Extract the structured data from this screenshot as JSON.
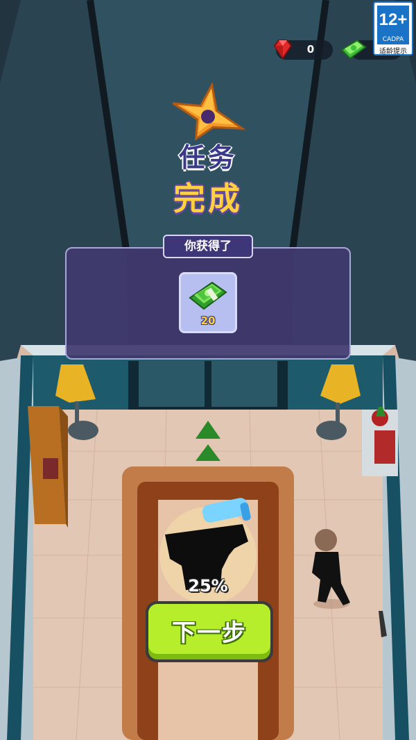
{
  "hud": {
    "gem_icon": "red-gem-icon",
    "gem_count": "0",
    "cash_icon": "cash-stack-icon",
    "cash_count": ""
  },
  "age_rating": {
    "age": "12+",
    "org": "CADPA",
    "caption": "适龄提示"
  },
  "result": {
    "icon": "shuriken-star-icon",
    "title_line1": "任务",
    "title_line2": "完成"
  },
  "reward_panel": {
    "header": "你获得了",
    "item_icon": "cash-stack-icon",
    "item_amount": "20"
  },
  "unlock": {
    "item_icon": "pistol-silhouette-icon",
    "progress_label": "25%",
    "progress_value": 0.25
  },
  "next_button": {
    "label": "下一步"
  },
  "colors": {
    "title_line1": "#3b3a8a",
    "title_line2": "#ffd23e",
    "button": "#b6ee2c",
    "panel": "#403a6e"
  }
}
